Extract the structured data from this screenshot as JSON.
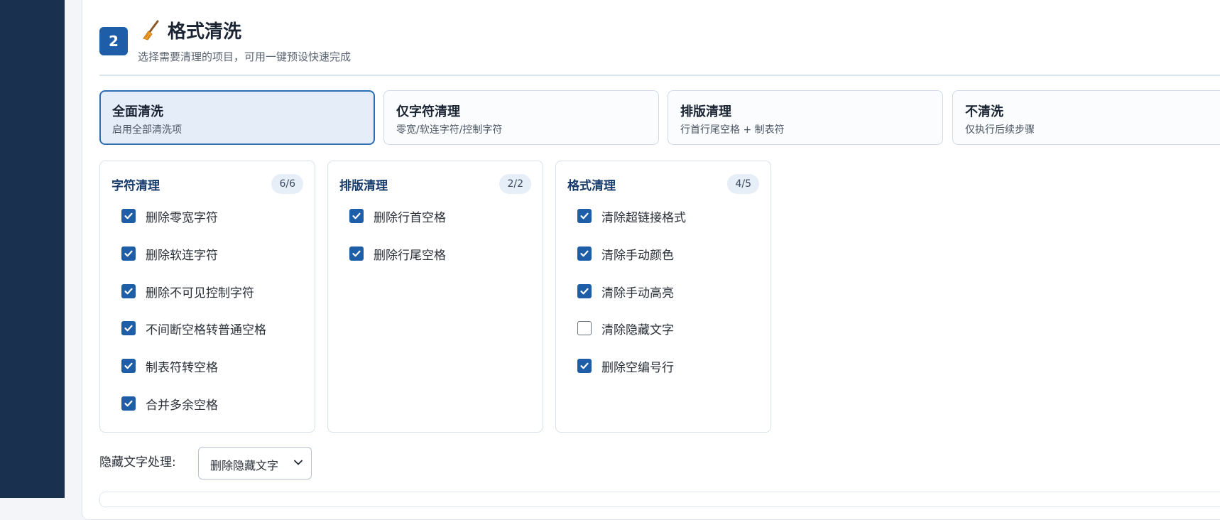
{
  "step": {
    "number": "2",
    "title": "格式清洗",
    "subtitle": "选择需要清理的项目，可用一键预设快速完成"
  },
  "presets": [
    {
      "title": "全面清洗",
      "desc": "启用全部清洗项",
      "active": true
    },
    {
      "title": "仅字符清理",
      "desc": "零宽/软连字符/控制字符",
      "active": false
    },
    {
      "title": "排版清理",
      "desc": "行首行尾空格 + 制表符",
      "active": false
    },
    {
      "title": "不清洗",
      "desc": "仅执行后续步骤",
      "active": false
    }
  ],
  "groups": [
    {
      "title": "字符清理",
      "count": "6/6",
      "options": [
        {
          "label": "删除零宽字符",
          "checked": true
        },
        {
          "label": "删除软连字符",
          "checked": true
        },
        {
          "label": "删除不可见控制字符",
          "checked": true
        },
        {
          "label": "不间断空格转普通空格",
          "checked": true
        },
        {
          "label": "制表符转空格",
          "checked": true
        },
        {
          "label": "合并多余空格",
          "checked": true
        }
      ]
    },
    {
      "title": "排版清理",
      "count": "2/2",
      "options": [
        {
          "label": "删除行首空格",
          "checked": true
        },
        {
          "label": "删除行尾空格",
          "checked": true
        }
      ]
    },
    {
      "title": "格式清理",
      "count": "4/5",
      "options": [
        {
          "label": "清除超链接格式",
          "checked": true
        },
        {
          "label": "清除手动颜色",
          "checked": true
        },
        {
          "label": "清除手动高亮",
          "checked": true
        },
        {
          "label": "清除隐藏文字",
          "checked": false
        },
        {
          "label": "删除空编号行",
          "checked": true
        }
      ]
    }
  ],
  "hidden_text": {
    "label": "隐藏文字处理:",
    "selected": "删除隐藏文字"
  },
  "colors": {
    "accent": "#1e5ea8",
    "sidebar": "#19304f",
    "title": "#153a6b"
  }
}
